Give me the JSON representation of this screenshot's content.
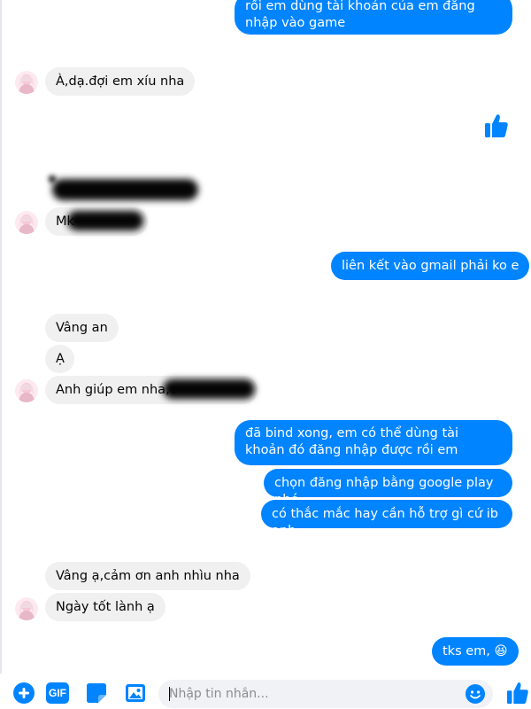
{
  "colors": {
    "outgoing_bubble": "#0084ff",
    "incoming_bubble": "#f0f0f0",
    "accent": "#0084ff"
  },
  "messages": [
    {
      "id": "m1",
      "side": "out",
      "text": "rồi em dùng tài khoản của em đăng nhập vào game"
    },
    {
      "id": "m2",
      "side": "in",
      "text": "À,dạ.đợi em xíu nha"
    },
    {
      "id": "m3",
      "side": "out",
      "icon": "thumbs-up-icon"
    },
    {
      "id": "m4",
      "side": "in",
      "text": "",
      "redacted": true
    },
    {
      "id": "m5",
      "side": "in",
      "text": "Mk",
      "redacted": true
    },
    {
      "id": "m6",
      "side": "out",
      "text": "liên kết vào gmail phải ko e"
    },
    {
      "id": "m7",
      "side": "in",
      "text": "Vâng an"
    },
    {
      "id": "m8",
      "side": "in",
      "text": "Ạ"
    },
    {
      "id": "m9",
      "side": "in",
      "text": "Anh giúp em nha,c",
      "redacted": true
    },
    {
      "id": "m10",
      "side": "out",
      "text": "đã bind xong, em có thể dùng tài khoản đó đăng nhập được rồi em"
    },
    {
      "id": "m11",
      "side": "out",
      "text": "chọn đăng nhập bằng google play nhé"
    },
    {
      "id": "m12",
      "side": "out",
      "text": "có thắc mắc hay cần hỗ trợ gì cứ ib anh"
    },
    {
      "id": "m13",
      "side": "in",
      "text": "Vâng ạ,cảm ơn anh nhìu nha"
    },
    {
      "id": "m14",
      "side": "in",
      "text": "Ngày tốt lành ạ"
    },
    {
      "id": "m15",
      "side": "out",
      "text": "tks em,",
      "emoji": "😆"
    }
  ],
  "composer": {
    "placeholder": "Nhập tin nhắn...",
    "actions": [
      "add-icon",
      "gif-icon",
      "sticker-icon",
      "image-icon"
    ],
    "gif_label": "GIF",
    "emoji_icon": "smile-icon",
    "send_icon": "thumbs-up-icon"
  }
}
